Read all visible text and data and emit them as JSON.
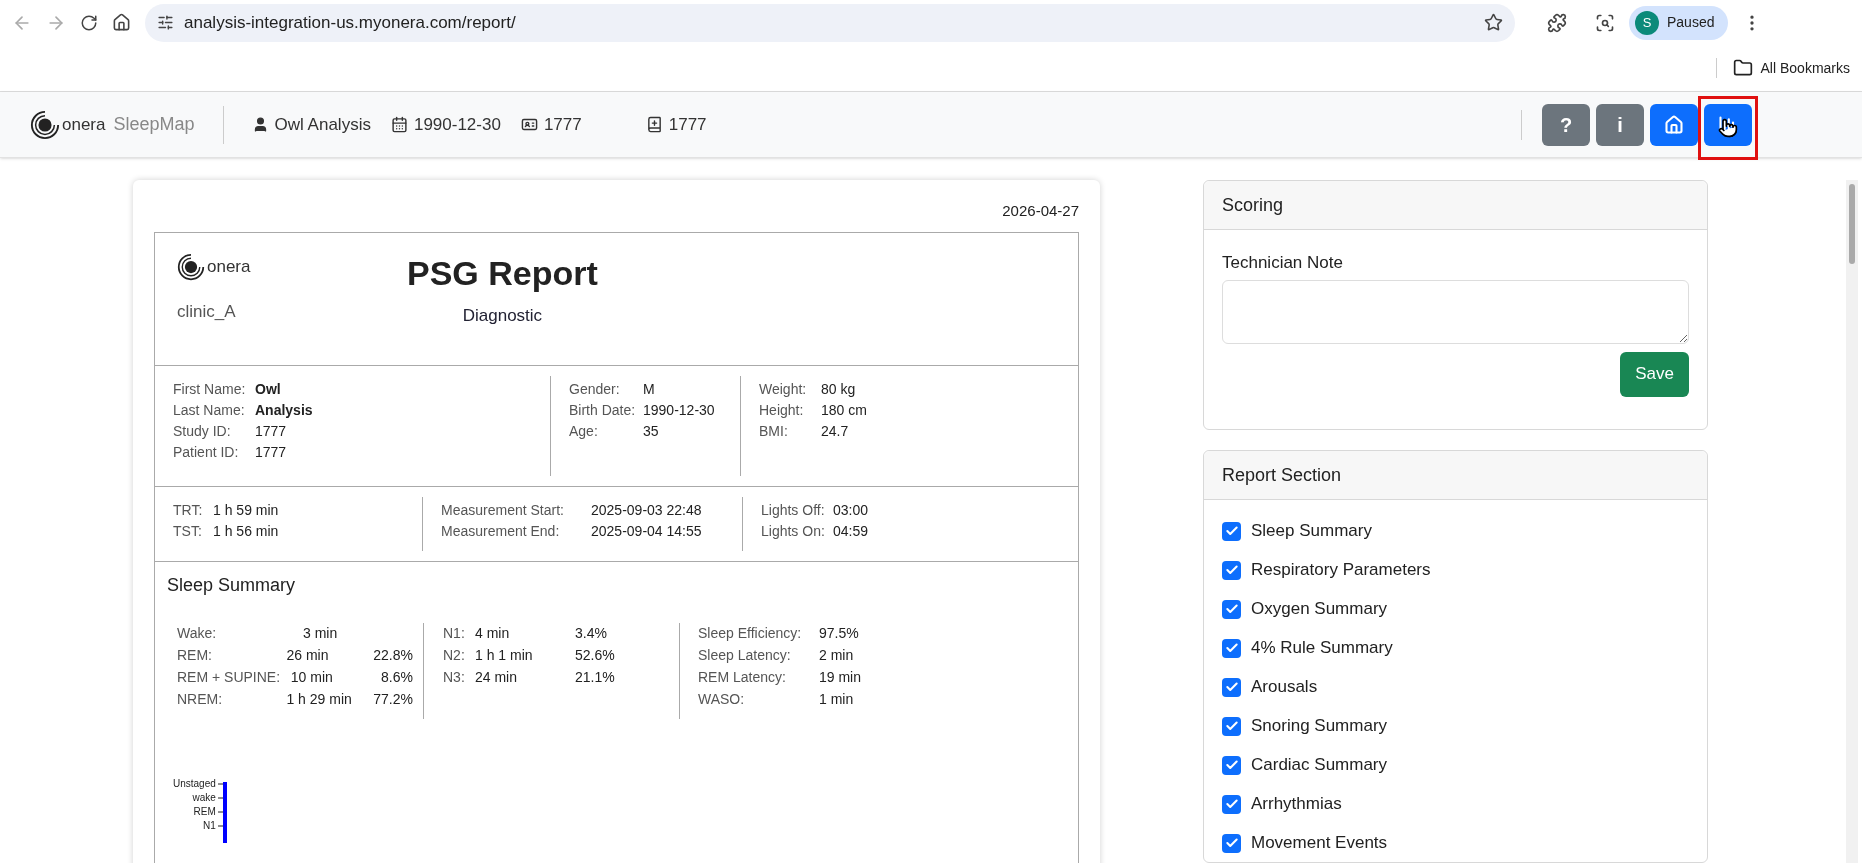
{
  "browser": {
    "url": "analysis-integration-us.myonera.com/report/",
    "profile": {
      "initial": "S",
      "status": "Paused"
    },
    "bookmarks": [
      {
        "label": "All Bookmarks"
      }
    ]
  },
  "app_header": {
    "brand": {
      "logo_text": "onera",
      "product": "SleepMap"
    },
    "patient_info": [
      {
        "kind": "person",
        "text": "Owl Analysis"
      },
      {
        "kind": "calendar",
        "text": "1990-12-30"
      },
      {
        "kind": "id",
        "text": "1777"
      },
      {
        "kind": "record",
        "text": "1777"
      }
    ],
    "buttons": [
      {
        "kind": "help",
        "label": "?",
        "highlighted": false
      },
      {
        "kind": "info",
        "label": "i",
        "highlighted": false
      },
      {
        "kind": "home",
        "highlighted": false
      },
      {
        "kind": "chart",
        "highlighted": true
      }
    ]
  },
  "report": {
    "date": "2026-04-27",
    "logo_text": "onera",
    "clinic": "clinic_A",
    "title": "PSG Report",
    "subtitle": "Diagnostic",
    "patient_columns": [
      [
        {
          "label": "First Name:",
          "value": "Owl",
          "bold": true
        },
        {
          "label": "Last Name:",
          "value": "Analysis",
          "bold": true
        },
        {
          "label": "Study ID:",
          "value": "1777",
          "bold": false
        },
        {
          "label": "Patient ID:",
          "value": "1777",
          "bold": false
        }
      ],
      [
        {
          "label": "Gender:",
          "value": "M",
          "bold": false
        },
        {
          "label": "Birth Date:",
          "value": "1990-12-30",
          "bold": false
        },
        {
          "label": "Age:",
          "value": "35",
          "bold": false
        }
      ],
      [
        {
          "label": "Weight:",
          "value": "80 kg",
          "bold": false
        },
        {
          "label": "Height:",
          "value": "180 cm",
          "bold": false
        },
        {
          "label": "BMI:",
          "value": "24.7",
          "bold": false
        }
      ]
    ],
    "time_columns": [
      [
        {
          "label": "TRT:",
          "value": "1 h 59 min"
        },
        {
          "label": "TST:",
          "value": "1 h 56 min"
        }
      ],
      [
        {
          "label": "Measurement Start:",
          "value": "2025-09-03 22:48"
        },
        {
          "label": "Measurement End:",
          "value": "2025-09-04 14:55"
        }
      ],
      [
        {
          "label": "Lights Off:",
          "value": "03:00"
        },
        {
          "label": "Lights On:",
          "value": "04:59"
        }
      ]
    ],
    "sleep_summary": {
      "title": "Sleep Summary",
      "columns": [
        [
          {
            "label": "Wake:",
            "values": [
              "3 min"
            ]
          },
          {
            "label": "REM:",
            "values": [
              "26 min",
              "22.8%"
            ]
          },
          {
            "label": "REM + SUPINE:",
            "values": [
              "10 min",
              "8.6%"
            ]
          },
          {
            "label": "NREM:",
            "values": [
              "1 h 29 min",
              "77.2%"
            ]
          }
        ],
        [
          {
            "label": "N1:",
            "values": [
              "4 min",
              "3.4%"
            ]
          },
          {
            "label": "N2:",
            "values": [
              "1 h 1 min",
              "52.6%"
            ]
          },
          {
            "label": "N3:",
            "values": [
              "24 min",
              "21.1%"
            ]
          }
        ],
        [
          {
            "label": "Sleep Efficiency:",
            "values": [
              "97.5%"
            ]
          },
          {
            "label": "Sleep Latency:",
            "values": [
              "2 min"
            ]
          },
          {
            "label": "REM Latency:",
            "values": [
              "19 min"
            ]
          },
          {
            "label": "WASO:",
            "values": [
              "1 min"
            ]
          }
        ]
      ]
    },
    "hypnogram": {
      "stage_labels": [
        "Unstaged",
        "wake",
        "REM",
        "N1"
      ]
    }
  },
  "scoring": {
    "title": "Scoring",
    "note_label": "Technician Note",
    "save_label": "Save"
  },
  "report_section": {
    "title": "Report Section",
    "items": [
      {
        "label": "Sleep Summary",
        "checked": true
      },
      {
        "label": "Respiratory Parameters",
        "checked": true
      },
      {
        "label": "Oxygen Summary",
        "checked": true
      },
      {
        "label": "4% Rule Summary",
        "checked": true
      },
      {
        "label": "Arousals",
        "checked": true
      },
      {
        "label": "Snoring Summary",
        "checked": true
      },
      {
        "label": "Cardiac Summary",
        "checked": true
      },
      {
        "label": "Arrhythmias",
        "checked": true
      },
      {
        "label": "Movement Events",
        "checked": true
      }
    ]
  }
}
